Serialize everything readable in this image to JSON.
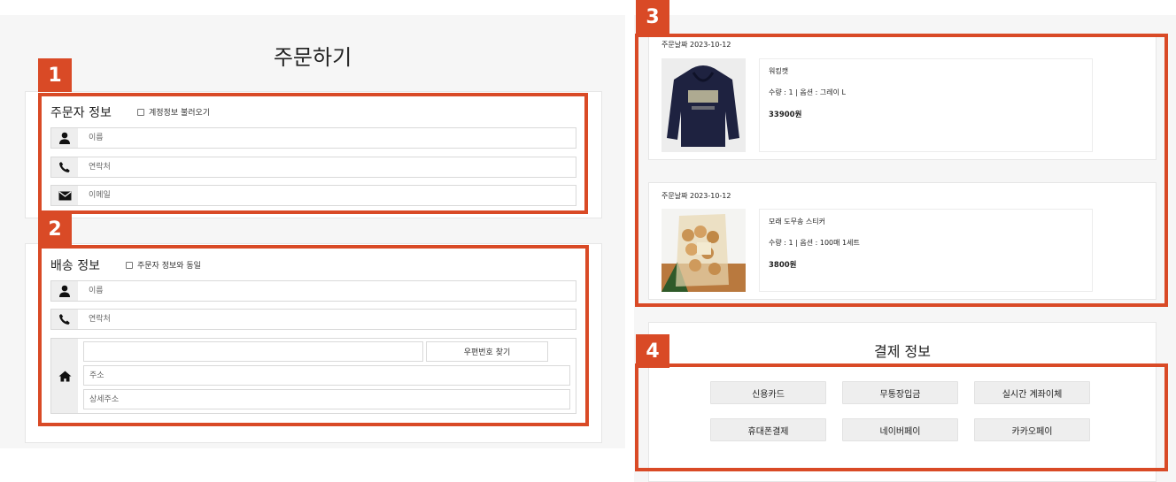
{
  "page_title": "주문하기",
  "badges": [
    "1",
    "2",
    "3",
    "4"
  ],
  "orderer": {
    "title": "주문자 정보",
    "checkbox_label": "계정정보 불러오기",
    "name_placeholder": "이름",
    "phone_placeholder": "연락처",
    "email_placeholder": "이메일"
  },
  "shipping": {
    "title": "배송 정보",
    "checkbox_label": "주문자 정보와 동일",
    "name_placeholder": "이름",
    "phone_placeholder": "연락처",
    "zipcode_value": "",
    "zip_button": "우편번호 찾기",
    "address_placeholder": "주소",
    "detail_address_placeholder": "상세주소"
  },
  "orders": [
    {
      "date": "주문날짜 2023-10-12",
      "product_name": "워킹캣",
      "quantity_option": "수량 : 1 | 옵션 : 그레이 L",
      "price": "33900원",
      "image": "navy-hoodie"
    },
    {
      "date": "주문날짜 2023-10-12",
      "product_name": "모래 도무송 스티커",
      "quantity_option": "수량 : 1 | 옵션 : 100매 1세트",
      "price": "3800원",
      "image": "snack-bag"
    }
  ],
  "payment": {
    "title": "결제 정보",
    "methods": [
      "신용카드",
      "무통장입금",
      "실시간 계좌이체",
      "휴대폰결제",
      "네이버페이",
      "카카오페이"
    ]
  },
  "colors": {
    "highlight": "#d94a26",
    "panel_bg": "#f6f6f6",
    "icon_bg": "#eeeeee"
  }
}
